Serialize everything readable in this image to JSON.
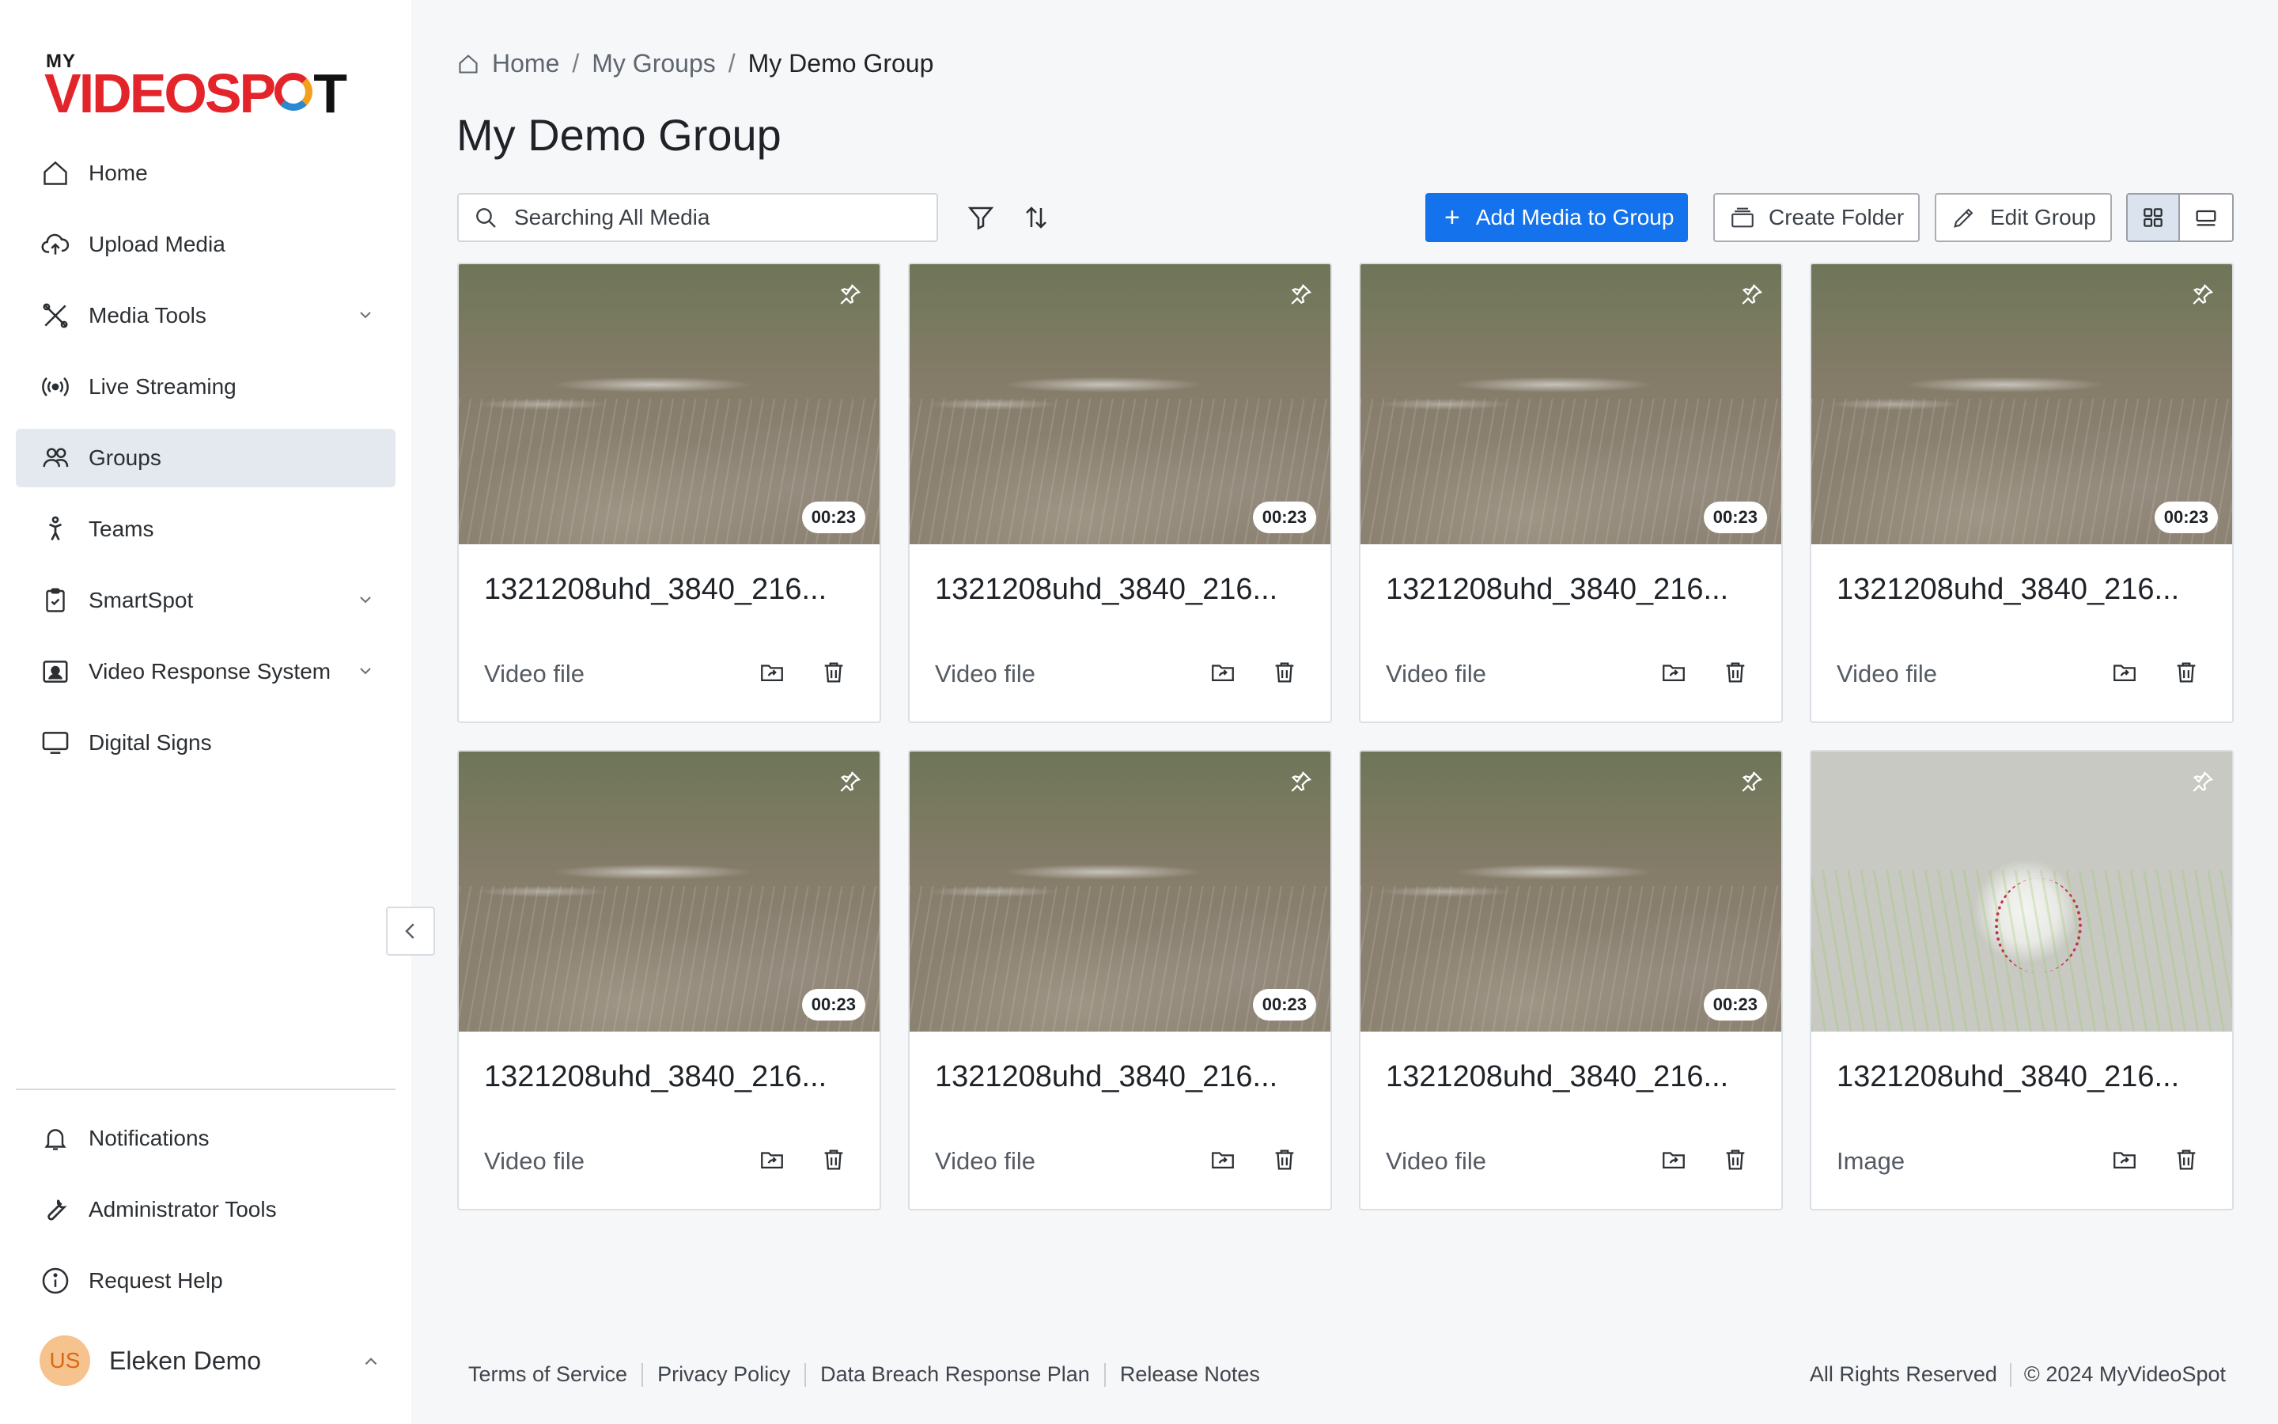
{
  "brand": {
    "logo_top": "MY",
    "logo_main_a": "VIDEOSP",
    "logo_main_b": "T"
  },
  "sidebar": {
    "items": [
      {
        "label": "Home",
        "icon": "home-icon"
      },
      {
        "label": "Upload Media",
        "icon": "upload-cloud-icon"
      },
      {
        "label": "Media Tools",
        "icon": "tools-icon",
        "has_submenu": true
      },
      {
        "label": "Live Streaming",
        "icon": "broadcast-icon"
      },
      {
        "label": "Groups",
        "icon": "users-icon",
        "active": true
      },
      {
        "label": "Teams",
        "icon": "person-icon"
      },
      {
        "label": "SmartSpot",
        "icon": "clipboard-icon",
        "has_submenu": true
      },
      {
        "label": "Video Response System",
        "icon": "id-card-icon",
        "has_submenu": true
      },
      {
        "label": "Digital Signs",
        "icon": "monitor-icon"
      }
    ],
    "bottom_items": [
      {
        "label": "Notifications",
        "icon": "bell-icon"
      },
      {
        "label": "Administrator Tools",
        "icon": "wrench-icon"
      },
      {
        "label": "Request Help",
        "icon": "info-icon"
      }
    ],
    "user": {
      "initials": "US",
      "name": "Eleken Demo"
    }
  },
  "breadcrumb": {
    "home": "Home",
    "parent": "My Groups",
    "current": "My Demo Group"
  },
  "page": {
    "title": "My Demo Group"
  },
  "toolbar": {
    "search_placeholder": "Searching All Media",
    "add_media_label": "Add Media to Group",
    "create_folder_label": "Create Folder",
    "edit_group_label": "Edit Group",
    "view_mode": "grid"
  },
  "media": [
    {
      "title": "1321208uhd_3840_216...",
      "type": "Video file",
      "duration": "00:23",
      "kind": "video"
    },
    {
      "title": "1321208uhd_3840_216...",
      "type": "Video file",
      "duration": "00:23",
      "kind": "video"
    },
    {
      "title": "1321208uhd_3840_216...",
      "type": "Video file",
      "duration": "00:23",
      "kind": "video"
    },
    {
      "title": "1321208uhd_3840_216...",
      "type": "Video file",
      "duration": "00:23",
      "kind": "video"
    },
    {
      "title": "1321208uhd_3840_216...",
      "type": "Video file",
      "duration": "00:23",
      "kind": "video"
    },
    {
      "title": "1321208uhd_3840_216...",
      "type": "Video file",
      "duration": "00:23",
      "kind": "video"
    },
    {
      "title": "1321208uhd_3840_216...",
      "type": "Video file",
      "duration": "00:23",
      "kind": "video"
    },
    {
      "title": "1321208uhd_3840_216...",
      "type": "Image",
      "duration": null,
      "kind": "image"
    }
  ],
  "footer": {
    "links": [
      "Terms of Service",
      "Privacy Policy",
      "Data Breach Response Plan",
      "Release Notes"
    ],
    "rights": "All Rights Reserved",
    "copyright": "© 2024 MyVideoSpot"
  },
  "colors": {
    "accent": "#1372ec",
    "brand_red": "#e4242b",
    "active_nav": "#e3e9ef"
  }
}
